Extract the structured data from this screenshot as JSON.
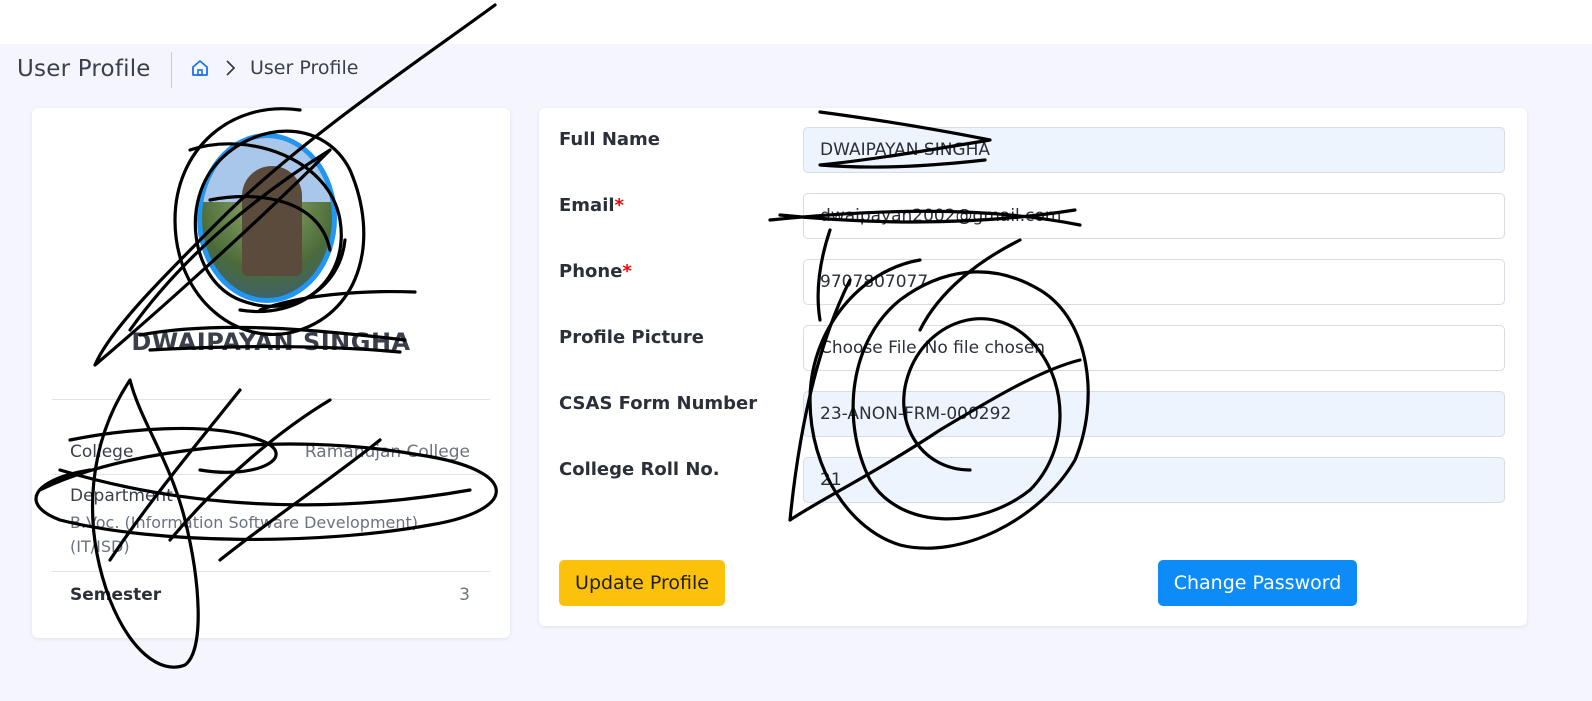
{
  "header": {
    "page_title": "User Profile",
    "breadcrumb": {
      "home_icon": "home-icon",
      "separator_icon": "chevron-right-icon",
      "current": "User Profile"
    }
  },
  "profile_card": {
    "avatar": "profile-photo",
    "name": "DWAIPAYAN SINGHA",
    "college_label": "College",
    "college_value": "Ramanujan College",
    "department_label": "Department",
    "department_value": "B.Voc. (Information Software Development) (IT/ISD)",
    "semester_label": "Semester",
    "semester_value": "3"
  },
  "form": {
    "full_name": {
      "label": "Full Name",
      "value": "DWAIPAYAN SINGHA"
    },
    "email": {
      "label": "Email",
      "required_mark": "*",
      "value": "dwaipayan2002@gmail.com"
    },
    "phone": {
      "label": "Phone",
      "required_mark": "*",
      "value": "9707807077"
    },
    "profile_picture": {
      "label": "Profile Picture",
      "button": "Choose File",
      "status": "No file chosen"
    },
    "csas": {
      "label": "CSAS Form Number",
      "value": "23-ANON-FRM-000292"
    },
    "roll": {
      "label": "College Roll No.",
      "value": "21"
    }
  },
  "buttons": {
    "update": "Update Profile",
    "change_password": "Change Password"
  },
  "colors": {
    "background": "#f5f6fd",
    "avatar_ring": "#2196f3",
    "update_button": "#fcc10b",
    "password_button": "#0d8cf8",
    "required": "#ff0000"
  }
}
